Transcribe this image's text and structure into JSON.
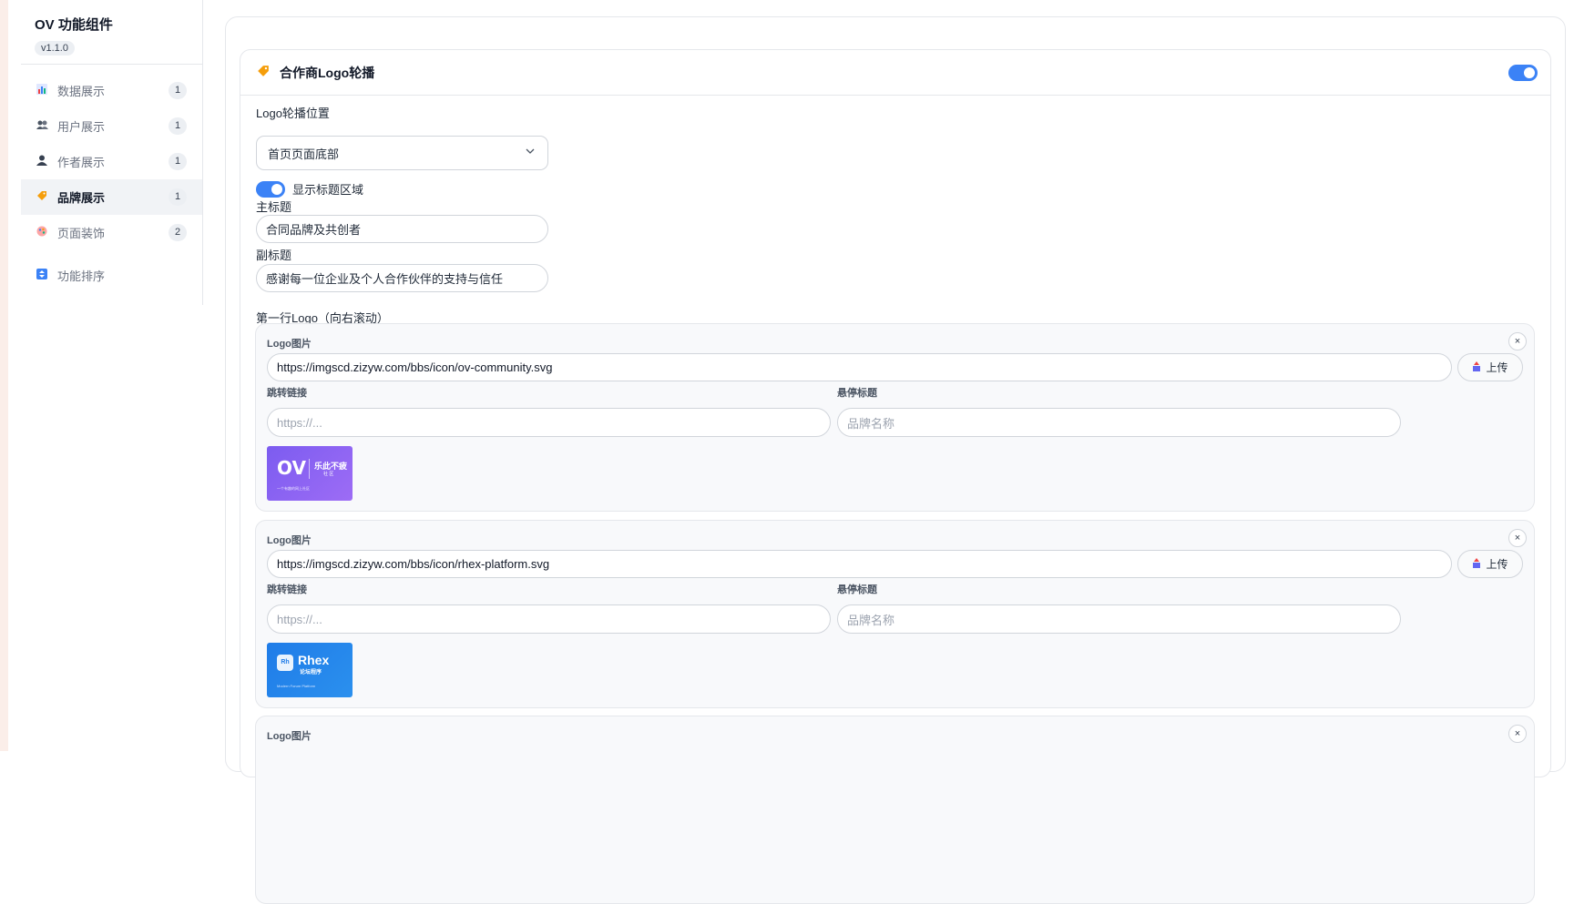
{
  "sidebar": {
    "title": "OV 功能组件",
    "version": "v1.1.0",
    "items": [
      {
        "label": "数据展示",
        "count": "1",
        "icon": "bar-chart-icon"
      },
      {
        "label": "用户展示",
        "count": "1",
        "icon": "users-icon"
      },
      {
        "label": "作者展示",
        "count": "1",
        "icon": "user-icon"
      },
      {
        "label": "品牌展示",
        "count": "1",
        "icon": "tag-icon"
      },
      {
        "label": "页面装饰",
        "count": "2",
        "icon": "decoration-icon"
      }
    ],
    "sort": {
      "label": "功能排序",
      "icon": "sort-icon"
    },
    "active_index": 3
  },
  "panel": {
    "title": "合作商Logo轮播",
    "enabled": true,
    "position_label": "Logo轮播位置",
    "position_value": "首页页面底部",
    "show_title_label": "显示标题区域",
    "show_title_enabled": true,
    "main_title_label": "主标题",
    "main_title_value": "合同品牌及共创者",
    "subtitle_label": "副标题",
    "subtitle_value": "感谢每一位企业及个人合作伙伴的支持与信任",
    "first_row_label": "第一行Logo（向右滚动）"
  },
  "logo_card_labels": {
    "image": "Logo图片",
    "upload": "上传",
    "link": "跳转链接",
    "hover_title": "悬停标题",
    "link_placeholder": "https://...",
    "hover_placeholder": "品牌名称",
    "remove": "×"
  },
  "logos": [
    {
      "url": "https://imgscd.zizyw.com/bbs/icon/ov-community.svg",
      "thumb": {
        "main": "OV",
        "side": "乐此不疲",
        "sub": "社 区",
        "tagline": "一个有趣的网上社区"
      }
    },
    {
      "url": "https://imgscd.zizyw.com/bbs/icon/rhex-platform.svg",
      "thumb": {
        "badge": "Rh",
        "main": "Rhex",
        "sub": "论坛程序",
        "tagline": "Modern Forum Platform"
      }
    }
  ],
  "third_card_label": "Logo图片",
  "colors": {
    "accent": "#3b82f6",
    "ov_logo": "#7c5cf0",
    "rhex_logo": "#1f7ce8"
  }
}
